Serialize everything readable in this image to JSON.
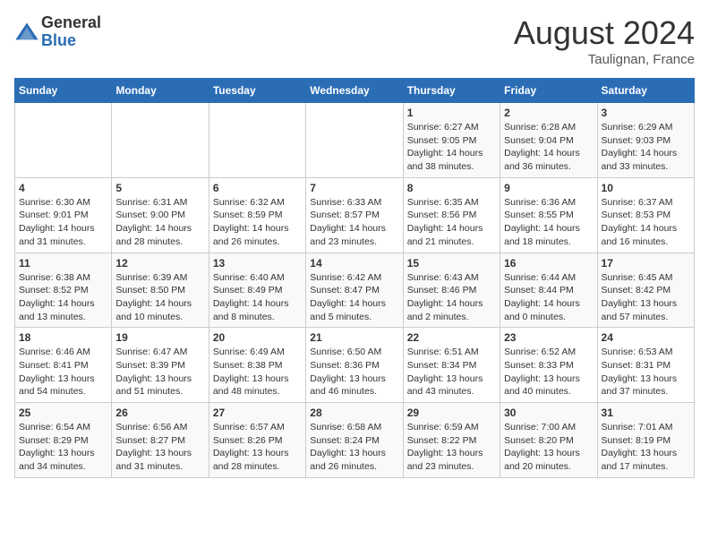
{
  "header": {
    "logo_line1": "General",
    "logo_line2": "Blue",
    "month_title": "August 2024",
    "location": "Taulignan, France"
  },
  "days_of_week": [
    "Sunday",
    "Monday",
    "Tuesday",
    "Wednesday",
    "Thursday",
    "Friday",
    "Saturday"
  ],
  "weeks": [
    [
      {
        "day": "",
        "info": ""
      },
      {
        "day": "",
        "info": ""
      },
      {
        "day": "",
        "info": ""
      },
      {
        "day": "",
        "info": ""
      },
      {
        "day": "1",
        "info": "Sunrise: 6:27 AM\nSunset: 9:05 PM\nDaylight: 14 hours and 38 minutes."
      },
      {
        "day": "2",
        "info": "Sunrise: 6:28 AM\nSunset: 9:04 PM\nDaylight: 14 hours and 36 minutes."
      },
      {
        "day": "3",
        "info": "Sunrise: 6:29 AM\nSunset: 9:03 PM\nDaylight: 14 hours and 33 minutes."
      }
    ],
    [
      {
        "day": "4",
        "info": "Sunrise: 6:30 AM\nSunset: 9:01 PM\nDaylight: 14 hours and 31 minutes."
      },
      {
        "day": "5",
        "info": "Sunrise: 6:31 AM\nSunset: 9:00 PM\nDaylight: 14 hours and 28 minutes."
      },
      {
        "day": "6",
        "info": "Sunrise: 6:32 AM\nSunset: 8:59 PM\nDaylight: 14 hours and 26 minutes."
      },
      {
        "day": "7",
        "info": "Sunrise: 6:33 AM\nSunset: 8:57 PM\nDaylight: 14 hours and 23 minutes."
      },
      {
        "day": "8",
        "info": "Sunrise: 6:35 AM\nSunset: 8:56 PM\nDaylight: 14 hours and 21 minutes."
      },
      {
        "day": "9",
        "info": "Sunrise: 6:36 AM\nSunset: 8:55 PM\nDaylight: 14 hours and 18 minutes."
      },
      {
        "day": "10",
        "info": "Sunrise: 6:37 AM\nSunset: 8:53 PM\nDaylight: 14 hours and 16 minutes."
      }
    ],
    [
      {
        "day": "11",
        "info": "Sunrise: 6:38 AM\nSunset: 8:52 PM\nDaylight: 14 hours and 13 minutes."
      },
      {
        "day": "12",
        "info": "Sunrise: 6:39 AM\nSunset: 8:50 PM\nDaylight: 14 hours and 10 minutes."
      },
      {
        "day": "13",
        "info": "Sunrise: 6:40 AM\nSunset: 8:49 PM\nDaylight: 14 hours and 8 minutes."
      },
      {
        "day": "14",
        "info": "Sunrise: 6:42 AM\nSunset: 8:47 PM\nDaylight: 14 hours and 5 minutes."
      },
      {
        "day": "15",
        "info": "Sunrise: 6:43 AM\nSunset: 8:46 PM\nDaylight: 14 hours and 2 minutes."
      },
      {
        "day": "16",
        "info": "Sunrise: 6:44 AM\nSunset: 8:44 PM\nDaylight: 14 hours and 0 minutes."
      },
      {
        "day": "17",
        "info": "Sunrise: 6:45 AM\nSunset: 8:42 PM\nDaylight: 13 hours and 57 minutes."
      }
    ],
    [
      {
        "day": "18",
        "info": "Sunrise: 6:46 AM\nSunset: 8:41 PM\nDaylight: 13 hours and 54 minutes."
      },
      {
        "day": "19",
        "info": "Sunrise: 6:47 AM\nSunset: 8:39 PM\nDaylight: 13 hours and 51 minutes."
      },
      {
        "day": "20",
        "info": "Sunrise: 6:49 AM\nSunset: 8:38 PM\nDaylight: 13 hours and 48 minutes."
      },
      {
        "day": "21",
        "info": "Sunrise: 6:50 AM\nSunset: 8:36 PM\nDaylight: 13 hours and 46 minutes."
      },
      {
        "day": "22",
        "info": "Sunrise: 6:51 AM\nSunset: 8:34 PM\nDaylight: 13 hours and 43 minutes."
      },
      {
        "day": "23",
        "info": "Sunrise: 6:52 AM\nSunset: 8:33 PM\nDaylight: 13 hours and 40 minutes."
      },
      {
        "day": "24",
        "info": "Sunrise: 6:53 AM\nSunset: 8:31 PM\nDaylight: 13 hours and 37 minutes."
      }
    ],
    [
      {
        "day": "25",
        "info": "Sunrise: 6:54 AM\nSunset: 8:29 PM\nDaylight: 13 hours and 34 minutes."
      },
      {
        "day": "26",
        "info": "Sunrise: 6:56 AM\nSunset: 8:27 PM\nDaylight: 13 hours and 31 minutes."
      },
      {
        "day": "27",
        "info": "Sunrise: 6:57 AM\nSunset: 8:26 PM\nDaylight: 13 hours and 28 minutes."
      },
      {
        "day": "28",
        "info": "Sunrise: 6:58 AM\nSunset: 8:24 PM\nDaylight: 13 hours and 26 minutes."
      },
      {
        "day": "29",
        "info": "Sunrise: 6:59 AM\nSunset: 8:22 PM\nDaylight: 13 hours and 23 minutes."
      },
      {
        "day": "30",
        "info": "Sunrise: 7:00 AM\nSunset: 8:20 PM\nDaylight: 13 hours and 20 minutes."
      },
      {
        "day": "31",
        "info": "Sunrise: 7:01 AM\nSunset: 8:19 PM\nDaylight: 13 hours and 17 minutes."
      }
    ]
  ]
}
